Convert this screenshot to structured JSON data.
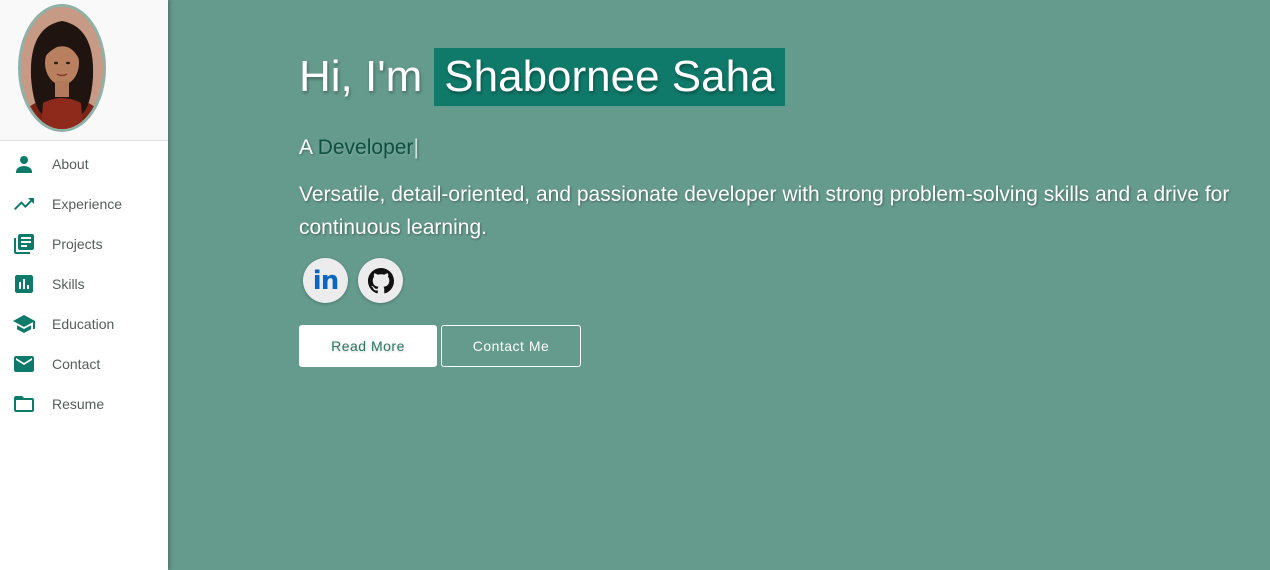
{
  "sidebar": {
    "avatar_alt": "Profile photo",
    "items": [
      {
        "label": "About",
        "icon": "person-icon"
      },
      {
        "label": "Experience",
        "icon": "trending-up-icon"
      },
      {
        "label": "Projects",
        "icon": "library-books-icon"
      },
      {
        "label": "Skills",
        "icon": "bar-chart-icon"
      },
      {
        "label": "Education",
        "icon": "school-icon"
      },
      {
        "label": "Contact",
        "icon": "mail-icon"
      },
      {
        "label": "Resume",
        "icon": "folder-icon"
      }
    ]
  },
  "hero": {
    "greeting": "Hi, I'm",
    "name": "Shabornee Saha",
    "role_prefix": "A",
    "role_typed": "Developer",
    "role_cursor": "|",
    "bio": "Versatile, detail-oriented, and passionate developer with strong problem-solving skills and a drive for continuous learning."
  },
  "socials": {
    "linkedin_label": "in",
    "linkedin_icon": "linkedin-icon",
    "github_icon": "github-icon"
  },
  "buttons": {
    "read_more": "Read More",
    "contact_me": "Contact Me"
  },
  "colors": {
    "background": "#659b8d",
    "accent": "#0f7a6a",
    "sidebar_icon": "#0e7a6a",
    "linkedin": "#0a66c2"
  }
}
